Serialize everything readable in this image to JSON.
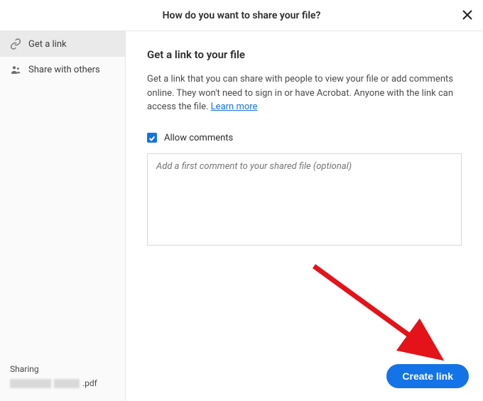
{
  "header": {
    "title": "How do you want to share your file?"
  },
  "sidebar": {
    "items": [
      {
        "label": "Get a link"
      },
      {
        "label": "Share with others"
      }
    ],
    "sharing_label": "Sharing",
    "file_ext": ".pdf"
  },
  "main": {
    "heading": "Get a link to your file",
    "description_pre": "Get a link that you can share with people to view your file or add comments online. They won't need to sign in or have Acrobat. Anyone with the link can access the file. ",
    "learn_more": "Learn more",
    "allow_comments_label": "Allow comments",
    "comment_placeholder": "Add a first comment to your shared file (optional)",
    "create_link_label": "Create link"
  },
  "colors": {
    "accent": "#1473e6",
    "arrow": "#e4131a"
  }
}
